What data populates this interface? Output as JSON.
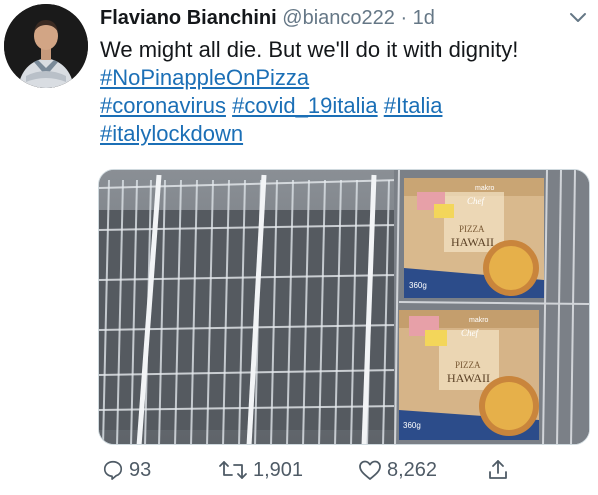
{
  "tweet": {
    "author_name": "Flaviano Bianchini",
    "author_handle": "@bianco222",
    "separator": "·",
    "timestamp": "1d",
    "text": "We might all die. But we'll do it with dignity!",
    "hashtags": [
      "#NoPinappleOnPizza",
      "#coronavirus",
      "#covid_19italia",
      "#Italia",
      "#italylockdown"
    ]
  },
  "media": {
    "description_icon": "photo",
    "box_lines": {
      "brand": "makro",
      "sub_brand": "Chef",
      "product": "PIZZA",
      "variant": "HAWAII",
      "weight": "360g"
    }
  },
  "actions": {
    "replies": "93",
    "retweets": "1,901",
    "likes": "8,262"
  },
  "colors": {
    "hashtag": "#1b6fb6",
    "text": "#14171a",
    "muted": "#657786"
  }
}
